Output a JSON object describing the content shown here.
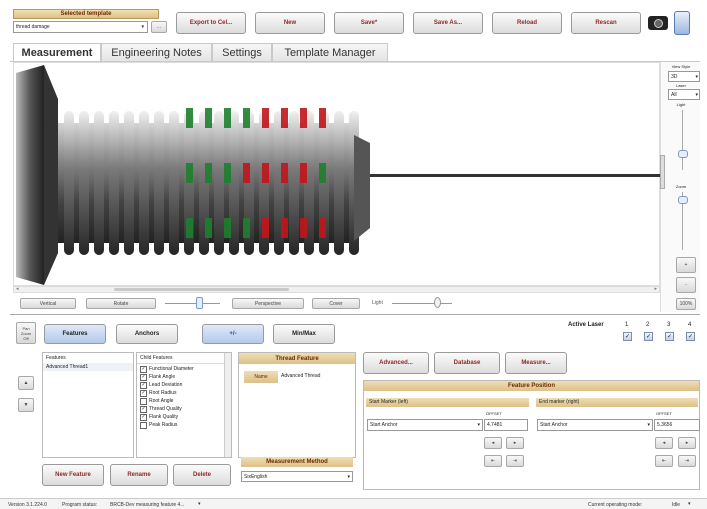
{
  "template": {
    "header": "Selected template",
    "value": "thread damage",
    "ellipsis": "..."
  },
  "toolbar": [
    "Export to Cel...",
    "New",
    "Save*",
    "Save As...",
    "Reload",
    "Rescan"
  ],
  "tabs": [
    "Measurement",
    "Engineering Notes",
    "Settings",
    "Template Manager"
  ],
  "viewstyle": {
    "view_style": "View Style",
    "view_value": "3D",
    "laser": "Laser",
    "laser_value": "All",
    "light": "Light",
    "zoom": "Zoom",
    "percent": "100%",
    "plus": "+",
    "minus": "-"
  },
  "viewbar": {
    "buttons": [
      "Vertical",
      "Rotate",
      "Perspective",
      "Cover"
    ],
    "light": "Light"
  },
  "left": {
    "pan_zoom": [
      "Pan",
      "Zoom",
      "Off"
    ],
    "up": "▲",
    "down": "▼"
  },
  "tabs2": {
    "features": "Features",
    "anchors": "Anchors",
    "plus_minus": "+/-",
    "minmax": "Min/Max"
  },
  "features_list": {
    "items": [
      "Features",
      "Advanced Thread1"
    ]
  },
  "child_features": {
    "title": "Child Features",
    "items": [
      {
        "label": "Functional Diameter",
        "checked": true
      },
      {
        "label": "Flank Angle",
        "checked": true
      },
      {
        "label": "Lead Deviation",
        "checked": true
      },
      {
        "label": "Root Radius",
        "checked": true
      },
      {
        "label": "Root Angle",
        "checked": false
      },
      {
        "label": "Thread Quality",
        "checked": true
      },
      {
        "label": "Flank Quality",
        "checked": true
      },
      {
        "label": "Peak Radius",
        "checked": false
      }
    ]
  },
  "thread_feature": {
    "title": "Thread Feature",
    "name_label": "Name",
    "name_value": "Advanced Thread",
    "method_title": "Measurement Method",
    "method_value": "SixEnglish"
  },
  "actions": {
    "advanced": "Advanced...",
    "database": "Database",
    "measure": "Measure..."
  },
  "bottom_buttons": [
    "New Feature",
    "Rename",
    "Delete"
  ],
  "active_laser": {
    "label": "Active Laser",
    "numbers": [
      "1",
      "2",
      "3",
      "4"
    ],
    "checked": [
      true,
      true,
      true,
      true
    ]
  },
  "feature_position": {
    "title": "Feature Position",
    "start": {
      "title": "Start Marker (left)",
      "offset_label": "OFFSET",
      "anchor": "Start Anchor",
      "offset": "4.7481"
    },
    "end": {
      "title": "End marker (right)",
      "offset_label": "OFFSET",
      "anchor": "Start Anchor",
      "offset": "5.3656"
    }
  },
  "status": {
    "version": "Version 3.1.224.0",
    "program_status": "Program status:",
    "status_value": "BRCB-Dev measuring feature 4...",
    "mode_label": "Current operating mode:",
    "mode_value": "Idle"
  },
  "icons": {
    "camera": "camera-icon",
    "sensor": "sensor-icon"
  },
  "colors": {
    "accent_header": "#dcc08a",
    "tab_active": "#ffffff",
    "green": "#1e7f2e",
    "red": "#c0151c"
  }
}
